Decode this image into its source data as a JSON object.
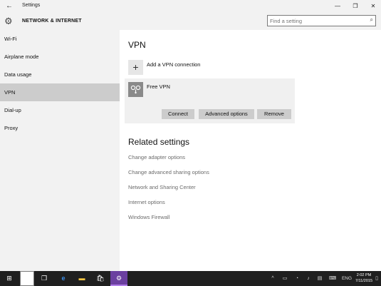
{
  "titlebar": {
    "back_glyph": "←",
    "title": "Settings",
    "min_glyph": "—",
    "max_glyph": "❐",
    "close_glyph": "✕"
  },
  "header": {
    "section_title": "NETWORK & INTERNET",
    "gear_glyph": "⚙",
    "search": {
      "placeholder": "Find a setting",
      "value": "",
      "icon_glyph": "⌕"
    }
  },
  "sidebar": {
    "items": [
      {
        "label": "Wi-Fi",
        "active": false
      },
      {
        "label": "Airplane mode",
        "active": false
      },
      {
        "label": "Data usage",
        "active": false
      },
      {
        "label": "VPN",
        "active": true
      },
      {
        "label": "Dial-up",
        "active": false
      },
      {
        "label": "Proxy",
        "active": false
      }
    ]
  },
  "main": {
    "heading": "VPN",
    "add_connection": {
      "icon_glyph": "+",
      "label": "Add a VPN connection"
    },
    "vpn_item": {
      "name": "Free VPN",
      "buttons": {
        "connect": "Connect",
        "advanced": "Advanced options",
        "remove": "Remove"
      }
    },
    "related_heading": "Related settings",
    "related_links": [
      "Change adapter options",
      "Change advanced sharing options",
      "Network and Sharing Center",
      "Internet options",
      "Windows Firewall"
    ]
  },
  "taskbar": {
    "start_glyph": "⊞",
    "search_glyph": "⌕",
    "taskview_glyph": "❒",
    "edge_glyph": "e",
    "explorer_glyph": "▬",
    "store_glyph": "🛍",
    "settings_glyph": "⚙",
    "tray": {
      "chevron_glyph": "^",
      "battery_glyph": "▭",
      "network_glyph": "◔",
      "volume_glyph": "♪",
      "message_glyph": "▤",
      "keyboard_glyph": "⌨",
      "notif_glyph": "▯",
      "language": "ENG",
      "time": "2:02 PM",
      "date": "7/11/2015"
    }
  },
  "colors": {
    "chrome_bg": "#f2f2f2",
    "active_nav": "#cccccc",
    "button_bg": "#cccccc",
    "link_text": "#6b6b6b",
    "taskbar_bg": "#1f1f1f",
    "settings_tile": "#6b3fa0"
  }
}
